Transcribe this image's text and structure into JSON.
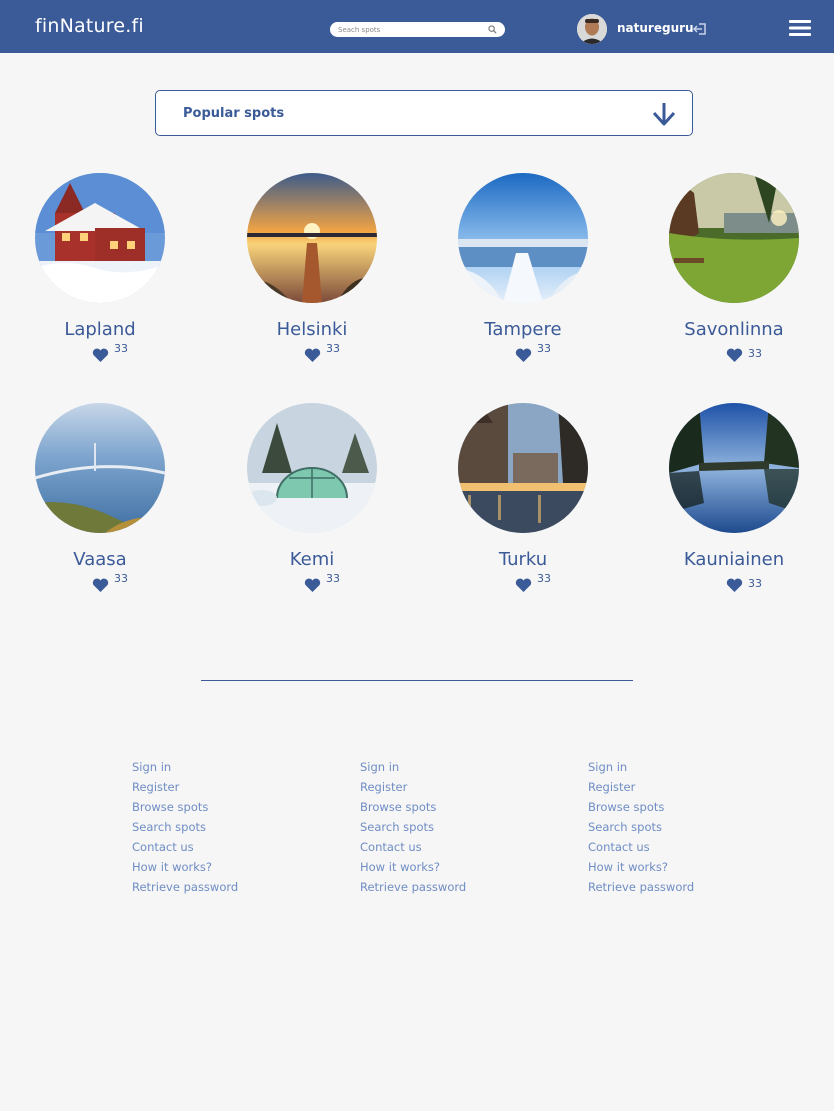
{
  "header": {
    "logo": "finNature.fi",
    "search_placeholder": "Seach spots",
    "username": "natureguru",
    "brand_color": "#3b5a98"
  },
  "dropdown": {
    "label": "Popular spots"
  },
  "spots": [
    {
      "name": "Lapland",
      "likes": "33"
    },
    {
      "name": "Helsinki",
      "likes": "33"
    },
    {
      "name": "Tampere",
      "likes": "33"
    },
    {
      "name": "Savonlinna",
      "likes": "33"
    },
    {
      "name": "Vaasa",
      "likes": "33"
    },
    {
      "name": "Kemi",
      "likes": "33"
    },
    {
      "name": "Turku",
      "likes": "33"
    },
    {
      "name": "Kauniainen",
      "likes": "33"
    }
  ],
  "footer": {
    "columns": [
      {
        "links": [
          "Sign in",
          "Register",
          "Browse spots",
          "Search spots",
          "Contact us",
          "How it works?",
          "Retrieve password"
        ]
      },
      {
        "links": [
          "Sign in",
          "Register",
          "Browse spots",
          "Search spots",
          "Contact us",
          "How it works?",
          "Retrieve password"
        ]
      },
      {
        "links": [
          "Sign in",
          "Register",
          "Browse spots",
          "Search spots",
          "Contact us",
          "How it works?",
          "Retrieve password"
        ]
      }
    ]
  }
}
